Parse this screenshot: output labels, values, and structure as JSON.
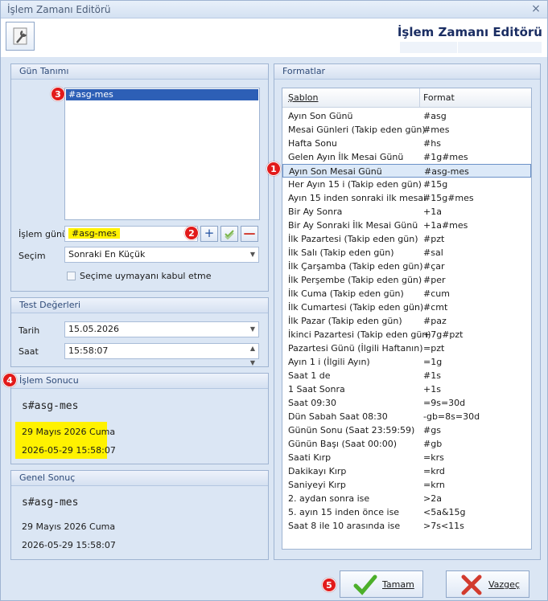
{
  "window": {
    "title": "İşlem Zamanı Editörü",
    "close_glyph": "×"
  },
  "header": {
    "title": "İşlem Zamanı Editörü",
    "tool_icon": "wrench-icon"
  },
  "gun_tanimi": {
    "title": "Gün Tanımı",
    "list_items": [
      "#asg-mes"
    ],
    "islem_gunu_label": "İşlem günü",
    "islem_gunu_value": "#asg-mes",
    "add_glyph": "+",
    "remove_glyph": "—",
    "secim_label": "Seçim",
    "secim_value": "Sonraki En Küçük",
    "checkbox_label": "Seçime uymayanı kabul etme"
  },
  "test_degerleri": {
    "title": "Test Değerleri",
    "tarih_label": "Tarih",
    "tarih_value": "15.05.2026",
    "saat_label": "Saat",
    "saat_value": "15:58:07"
  },
  "islem_sonucu": {
    "title": "İşlem Sonucu",
    "expression": "s#asg-mes",
    "date_text": "29 Mayıs 2026 Cuma",
    "datetime_text": "2026-05-29 15:58:07"
  },
  "genel_sonuc": {
    "title": "Genel Sonuç",
    "expression": "s#asg-mes",
    "date_text": "29 Mayıs 2026 Cuma",
    "datetime_text": "2026-05-29 15:58:07"
  },
  "formatlar": {
    "title": "Formatlar",
    "col_sablon": "Şablon",
    "col_format": "Format",
    "rows": [
      {
        "sablon": "Ayın Son Günü",
        "format": "#asg"
      },
      {
        "sablon": "Mesai Günleri  (Takip eden gün)",
        "format": "#mes"
      },
      {
        "sablon": "Hafta Sonu",
        "format": "#hs"
      },
      {
        "sablon": "Gelen Ayın İlk Mesai Günü",
        "format": "#1g#mes"
      },
      {
        "sablon": "Ayın Son Mesai Günü",
        "format": "#asg-mes"
      },
      {
        "sablon": "Her Ayın 15 i  (Takip eden gün)",
        "format": "#15g"
      },
      {
        "sablon": "Ayın 15 inden sonraki ilk mesai",
        "format": "#15g#mes"
      },
      {
        "sablon": "Bir Ay Sonra",
        "format": "+1a"
      },
      {
        "sablon": "Bir Ay Sonraki İlk Mesai Günü",
        "format": "+1a#mes"
      },
      {
        "sablon": "İlk Pazartesi (Takip eden gün)",
        "format": "#pzt"
      },
      {
        "sablon": "İlk Salı (Takip eden gün)",
        "format": "#sal"
      },
      {
        "sablon": "İlk Çarşamba (Takip eden gün)",
        "format": "#çar"
      },
      {
        "sablon": "İlk Perşembe (Takip eden gün)",
        "format": "#per"
      },
      {
        "sablon": "İlk Cuma (Takip eden gün)",
        "format": "#cum"
      },
      {
        "sablon": "İlk Cumartesi (Takip eden gün)",
        "format": "#cmt"
      },
      {
        "sablon": "İlk Pazar (Takip eden gün)",
        "format": "#paz"
      },
      {
        "sablon": "İkinci Pazartesi (Takip eden gün)",
        "format": "+7g#pzt"
      },
      {
        "sablon": "Pazartesi Günü (İlgili Haftanın)",
        "format": "=pzt"
      },
      {
        "sablon": "Ayın 1 i (İlgili Ayın)",
        "format": "=1g"
      },
      {
        "sablon": "Saat 1 de",
        "format": "#1s"
      },
      {
        "sablon": "1 Saat Sonra",
        "format": "+1s"
      },
      {
        "sablon": "Saat 09:30",
        "format": "=9s=30d"
      },
      {
        "sablon": "Dün Sabah Saat 08:30",
        "format": "-gb=8s=30d"
      },
      {
        "sablon": "Günün Sonu (Saat 23:59:59)",
        "format": "#gs"
      },
      {
        "sablon": "Günün Başı (Saat 00:00)",
        "format": "#gb"
      },
      {
        "sablon": "Saati Kırp",
        "format": "=krs"
      },
      {
        "sablon": "Dakikayı Kırp",
        "format": "=krd"
      },
      {
        "sablon": "Saniyeyi Kırp",
        "format": "=krn"
      },
      {
        "sablon": "2. aydan sonra ise",
        "format": ">2a"
      },
      {
        "sablon": "5. ayın 15 inden önce ise",
        "format": "<5a&15g"
      },
      {
        "sablon": "Saat 8 ile 10 arasında ise",
        "format": ">7s<11s"
      }
    ],
    "active_row_index": 4
  },
  "buttons": {
    "ok_label": "Tamam",
    "cancel_label": "Vazgeç"
  },
  "badges": [
    "1",
    "2",
    "3",
    "4",
    "5"
  ],
  "colors": {
    "badge": "#e21a1a",
    "highlight": "#fff200",
    "selection": "#2d5fb6",
    "ok_check": "#4caf2a",
    "cancel_x": "#d23b2e"
  }
}
